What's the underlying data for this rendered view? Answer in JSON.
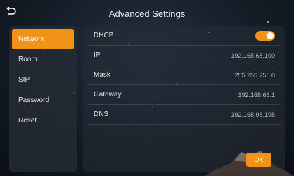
{
  "header": {
    "title": "Advanced Settings",
    "back_icon": "back-arrow-icon"
  },
  "sidebar": {
    "items": [
      {
        "label": "Network",
        "active": true
      },
      {
        "label": "Room",
        "active": false
      },
      {
        "label": "SIP",
        "active": false
      },
      {
        "label": "Password",
        "active": false
      },
      {
        "label": "Reset",
        "active": false
      }
    ]
  },
  "network": {
    "dhcp": {
      "label": "DHCP",
      "enabled": true
    },
    "ip": {
      "label": "IP",
      "value": "192.168.68.100"
    },
    "mask": {
      "label": "Mask",
      "value": "255.255.255.0"
    },
    "gateway": {
      "label": "Gateway",
      "value": "192.168.68.1"
    },
    "dns": {
      "label": "DNS",
      "value": "192.168.98.198"
    }
  },
  "actions": {
    "ok_label": "OK"
  },
  "colors": {
    "accent": "#f29216",
    "panel": "#262c36",
    "background": "#141c26"
  }
}
